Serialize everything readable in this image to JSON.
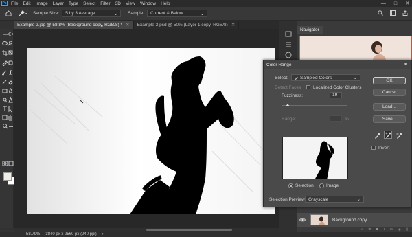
{
  "app": {
    "logo": "Ps"
  },
  "menu": [
    "File",
    "Edit",
    "Image",
    "Layer",
    "Type",
    "Select",
    "Filter",
    "3D",
    "View",
    "Window",
    "Help"
  ],
  "window_controls": {
    "minimize": "—",
    "maximize": "□",
    "close": "✕"
  },
  "options": {
    "sample_size_label": "Sample Size:",
    "sample_size_value": "5 by 3 Average",
    "sample_label": "Sample:",
    "sample_value": "Current & Below"
  },
  "tabs": [
    {
      "label": "Example 2.jpg @ 58.8% (Background copy, RGB/8) *",
      "active": true
    },
    {
      "label": "Example 2.psd @ 50% (Layer 1 copy, RGB/8)",
      "active": false
    }
  ],
  "status": {
    "zoom": "58.79%",
    "size": "3840 px x 2560 px (240 ppi)"
  },
  "navigator": {
    "tab_label": "Navigator"
  },
  "layers": {
    "layer_name": "Background copy"
  },
  "color_range": {
    "title": "Color Range",
    "select_label": "Select:",
    "select_value": "Sampled Colors",
    "detect_faces_label": "Detect Faces",
    "localized_label": "Localized Color Clusters",
    "localized_checked": false,
    "fuzziness_label": "Fuzziness:",
    "fuzziness_value": "19",
    "fuzziness_fraction": 0.09,
    "range_label": "Range:",
    "range_unit": "%",
    "selection_label": "Selection",
    "image_label": "Image",
    "preview_mode": "selection",
    "selection_preview_label": "Selection Preview:",
    "selection_preview_value": "Grayscale",
    "buttons": {
      "ok": "OK",
      "cancel": "Cancel",
      "load": "Load...",
      "save": "Save..."
    },
    "invert_label": "Invert",
    "invert_checked": false
  },
  "colors": {
    "accent": "#31a8ff",
    "foreground_swatch": "#f0ede6",
    "background_swatch": "#ffffff"
  }
}
